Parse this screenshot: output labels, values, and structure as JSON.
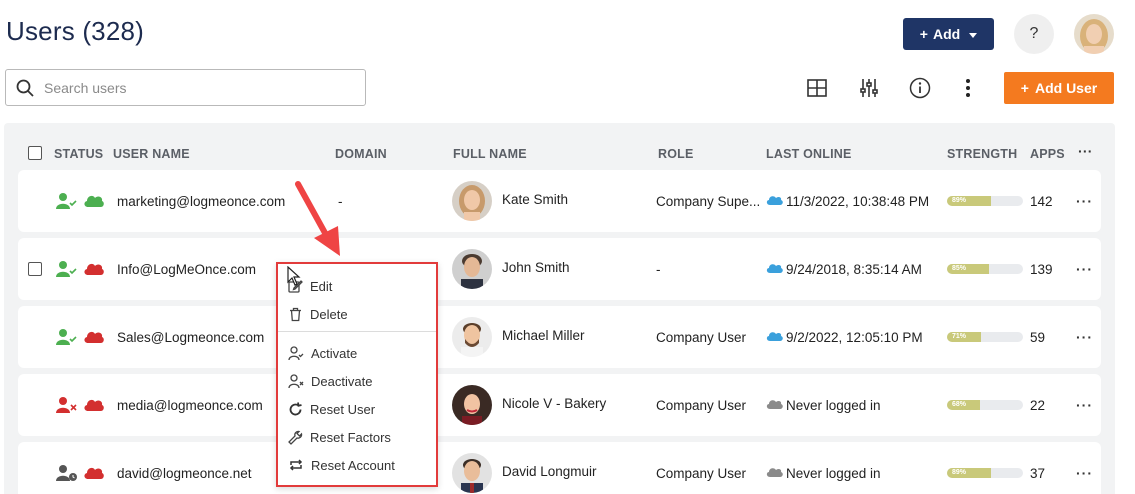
{
  "header": {
    "title": "Users (328)",
    "add_label": "Add",
    "help_label": "?",
    "add_user_label": "Add User"
  },
  "search": {
    "placeholder": "Search users"
  },
  "table": {
    "columns": {
      "status": "STATUS",
      "user_name": "USER NAME",
      "domain": "DOMAIN",
      "full_name": "FULL NAME",
      "role": "ROLE",
      "last_online": "LAST ONLINE",
      "strength": "STRENGTH",
      "apps": "APPS",
      "more": "···"
    },
    "rows": [
      {
        "user_name": "marketing@logmeonce.com",
        "domain": "-",
        "full_name": "Kate Smith",
        "role": "Company Supe...",
        "last_online": "11/3/2022, 10:38:48 PM",
        "strength_label": "89%",
        "strength": 89,
        "apps": "142",
        "online_status": "online",
        "active": true
      },
      {
        "user_name": "Info@LogMeOnce.com",
        "domain": "",
        "full_name": "John Smith",
        "role": "-",
        "last_online": "9/24/2018, 8:35:14 AM",
        "strength_label": "85%",
        "strength": 85,
        "apps": "139",
        "online_status": "online",
        "active": true
      },
      {
        "user_name": "Sales@Logmeonce.com",
        "domain": "",
        "full_name": "Michael Miller",
        "role": "Company User",
        "last_online": "9/2/2022, 12:05:10 PM",
        "strength_label": "71%",
        "strength": 71,
        "apps": "59",
        "online_status": "online",
        "active": true
      },
      {
        "user_name": "media@logmeonce.com",
        "domain": "",
        "full_name": "Nicole V - Bakery",
        "role": "Company User",
        "last_online": "Never logged in",
        "strength_label": "68%",
        "strength": 68,
        "apps": "22",
        "online_status": "never",
        "active": false
      },
      {
        "user_name": "david@logmeonce.net",
        "domain": "",
        "full_name": "David Longmuir",
        "role": "Company User",
        "last_online": "Never logged in",
        "strength_label": "89%",
        "strength": 89,
        "apps": "37",
        "online_status": "never",
        "active": "pending"
      }
    ]
  },
  "context_menu": {
    "items": [
      {
        "label": "Edit",
        "icon": "edit-icon"
      },
      {
        "label": "Delete",
        "icon": "trash-icon"
      },
      {
        "label": "Activate",
        "icon": "user-check-icon"
      },
      {
        "label": "Deactivate",
        "icon": "user-x-icon"
      },
      {
        "label": "Reset User",
        "icon": "refresh-icon"
      },
      {
        "label": "Reset Factors",
        "icon": "wrench-icon"
      },
      {
        "label": "Reset Account",
        "icon": "repeat-icon"
      }
    ]
  },
  "colors": {
    "navy": "#1f3566",
    "orange": "#f47a1f",
    "green": "#4caf50",
    "red": "#d32f2f",
    "cloud_blue": "#3aa0dc",
    "menu_border": "#e23b3b"
  }
}
